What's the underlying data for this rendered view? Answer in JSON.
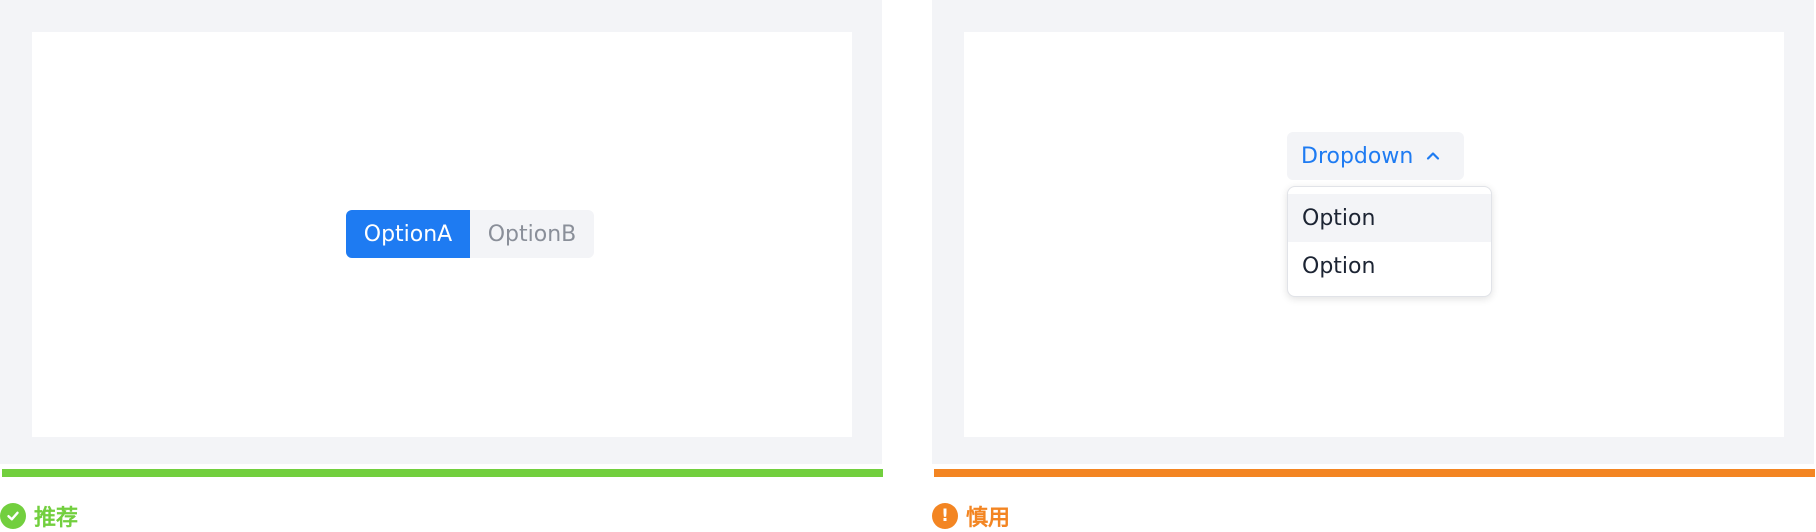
{
  "colors": {
    "primary": "#1e7bf2",
    "recommend": "#72cf3e",
    "caution": "#f38522",
    "panel_bg": "#f3f4f7"
  },
  "recommended": {
    "segmented": {
      "options": [
        {
          "label": "OptionA",
          "selected": true
        },
        {
          "label": "OptionB",
          "selected": false
        }
      ]
    },
    "caption": {
      "icon": "check-circle-icon",
      "label": "推荐"
    }
  },
  "caution": {
    "dropdown": {
      "label": "Dropdown",
      "icon": "chevron-up-icon",
      "expanded": true,
      "options": [
        "Option",
        "Option"
      ]
    },
    "caption": {
      "icon": "exclamation-circle-icon",
      "label": "慎用",
      "mark": "!"
    }
  }
}
